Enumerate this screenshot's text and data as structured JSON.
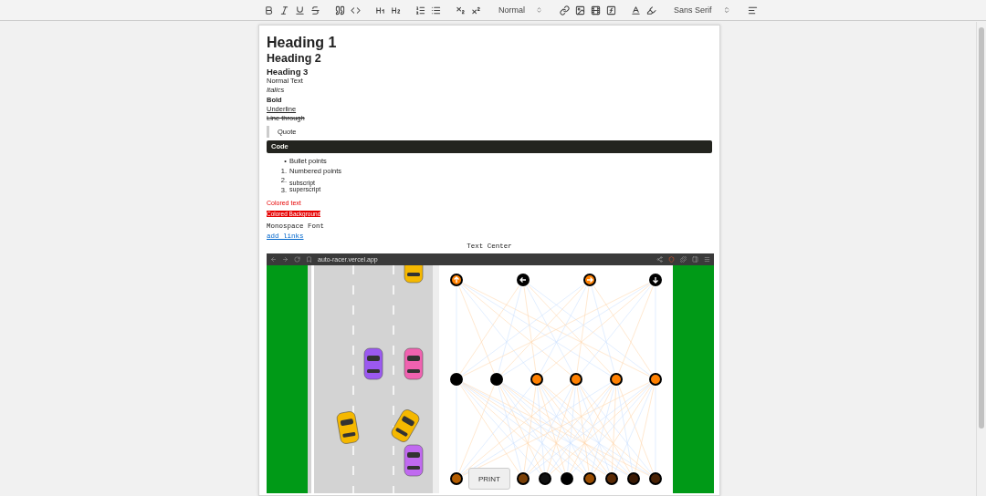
{
  "toolbar": {
    "header_select": "Normal",
    "font_select": "Sans Serif"
  },
  "document": {
    "blocks": [
      {
        "kind": "h1",
        "text": "Heading 1"
      },
      {
        "kind": "h2",
        "text": "Heading 2"
      },
      {
        "kind": "h3",
        "text": "Heading 3"
      },
      {
        "kind": "normal",
        "text": "Normal Text"
      },
      {
        "kind": "italic",
        "text": "Italics"
      },
      {
        "kind": "bold",
        "text": "Bold"
      },
      {
        "kind": "underline",
        "text": "Underline"
      },
      {
        "kind": "strike",
        "text": "Line through"
      },
      {
        "kind": "quote",
        "text": "Quote"
      },
      {
        "kind": "code",
        "text": "Code"
      },
      {
        "kind": "bullet",
        "marker": "•",
        "text": "Bullet points"
      },
      {
        "kind": "numbered",
        "marker": "1.",
        "text": "Numbered points"
      },
      {
        "kind": "subscript",
        "marker": "2.",
        "text": "subscript"
      },
      {
        "kind": "superscript",
        "marker": "3.",
        "text": "superscript"
      },
      {
        "kind": "color",
        "text": "Colored text"
      },
      {
        "kind": "background",
        "text": "Colored Background",
        "color": "#e60000"
      },
      {
        "kind": "mono",
        "text": "Monospace Font"
      },
      {
        "kind": "link",
        "text": "add links"
      },
      {
        "kind": "center",
        "text": "Text Center"
      }
    ]
  },
  "embedded_screenshot": {
    "url": "auto-racer.vercel.app",
    "print_button": "PRINT",
    "network": {
      "layers": [
        [
          {
            "color": "#ff8000",
            "kind": "up"
          },
          {
            "color": "#000000",
            "kind": "left"
          },
          {
            "color": "#ff8000",
            "kind": "right"
          },
          {
            "color": "#000000",
            "kind": "down"
          }
        ],
        [
          {
            "color": "#000000"
          },
          {
            "color": "#000000"
          },
          {
            "color": "#ff8000"
          },
          {
            "color": "#ff8000"
          },
          {
            "color": "#ff8000"
          },
          {
            "color": "#ff8000"
          }
        ],
        [
          {
            "color": "#b35c00"
          },
          {
            "color": "#7a4008"
          },
          {
            "color": "#111111"
          },
          {
            "color": "#000000"
          },
          {
            "color": "#9a4d00"
          },
          {
            "color": "#5a2a05"
          },
          {
            "color": "#3a1a05"
          },
          {
            "color": "#4a2306"
          }
        ]
      ]
    }
  }
}
